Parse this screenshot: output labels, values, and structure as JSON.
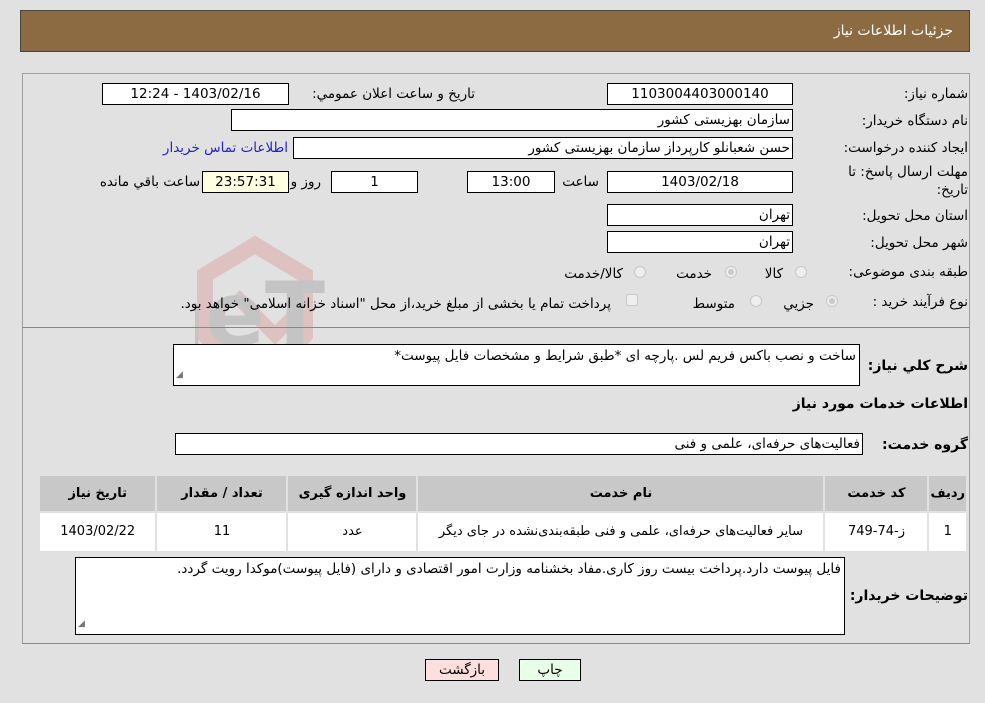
{
  "header": {
    "title": "جزئیات اطلاعات نیاز"
  },
  "form": {
    "need_number": {
      "label": "شماره نیاز:",
      "value": "1103004403000140"
    },
    "announce": {
      "label": "تاریخ و ساعت اعلان عمومي:",
      "value": "1403/02/16 - 12:24"
    },
    "buyer_org": {
      "label": "نام دستگاه خريدار:",
      "value": "سازمان بهزیستی کشور"
    },
    "requester": {
      "label": "ايجاد كننده درخواست:",
      "value": "حسن  شعبانلو کارپرداز سازمان بهزیستی کشور"
    },
    "contact_link": "اطلاعات تماس خريدار",
    "deadline": {
      "label_line1": "مهلت ارسال پاسخ: تا",
      "label_line2": "تاریخ:",
      "date": "1403/02/18",
      "time_label": "ساعت",
      "time": "13:00",
      "days": "1",
      "days_label": "روز و",
      "remaining": "23:57:31",
      "remaining_label": "ساعت باقي مانده"
    },
    "province": {
      "label": "استان محل تحويل:",
      "value": "تهران"
    },
    "city": {
      "label": "شهر محل تحويل:",
      "value": "تهران"
    },
    "category": {
      "label": "طبقه بندی موضوعی:",
      "options": [
        "کالا",
        "خدمت",
        "کالا/خدمت"
      ],
      "selected": "خدمت"
    },
    "process": {
      "label": "نوع فرآيند خريد :",
      "options": [
        "جزيي",
        "متوسط"
      ],
      "selected": "جزيي",
      "treasury_note": "پرداخت تمام یا بخشی از مبلغ خرید،از محل \"اسناد خزانه اسلامی\" خواهد بود."
    }
  },
  "description": {
    "label": "شرح كلي نياز:",
    "value": "ساخت و نصب باکس فریم لس .پارچه ای *طبق شرایط و مشخصات فایل پیوست*"
  },
  "services_section": {
    "title": "اطلاعات خدمات مورد نياز",
    "group_label": "گروه خدمت:",
    "group_value": "فعالیت‌های حرفه‌ای، علمی و فنی"
  },
  "table": {
    "headers": [
      "رديف",
      "كد خدمت",
      "نام خدمت",
      "واحد اندازه گيری",
      "تعداد / مقدار",
      "تاريخ نياز"
    ],
    "rows": [
      [
        "1",
        "ز-74-749",
        "سایر فعالیت‌های حرفه‌ای، علمی و فنی طبقه‌بندی‌نشده در جای دیگر",
        "عدد",
        "11",
        "1403/02/22"
      ]
    ]
  },
  "buyer_notes": {
    "label": "توضيحات خريدار:",
    "value": "فایل پیوست دارد.پرداخت بیست روز کاری.مفاد بخشنامه وزارت امور اقتصادی و دارای (فایل پیوست)موکدا رویت گردد."
  },
  "buttons": {
    "print": "چاپ",
    "back": "بازگشت"
  },
  "watermark": "AriaTender.neT",
  "colors": {
    "header_bg": "#8c6b42",
    "print_bg": "#e8ffe8",
    "back_bg": "#ffdede",
    "link": "#2222cc"
  }
}
